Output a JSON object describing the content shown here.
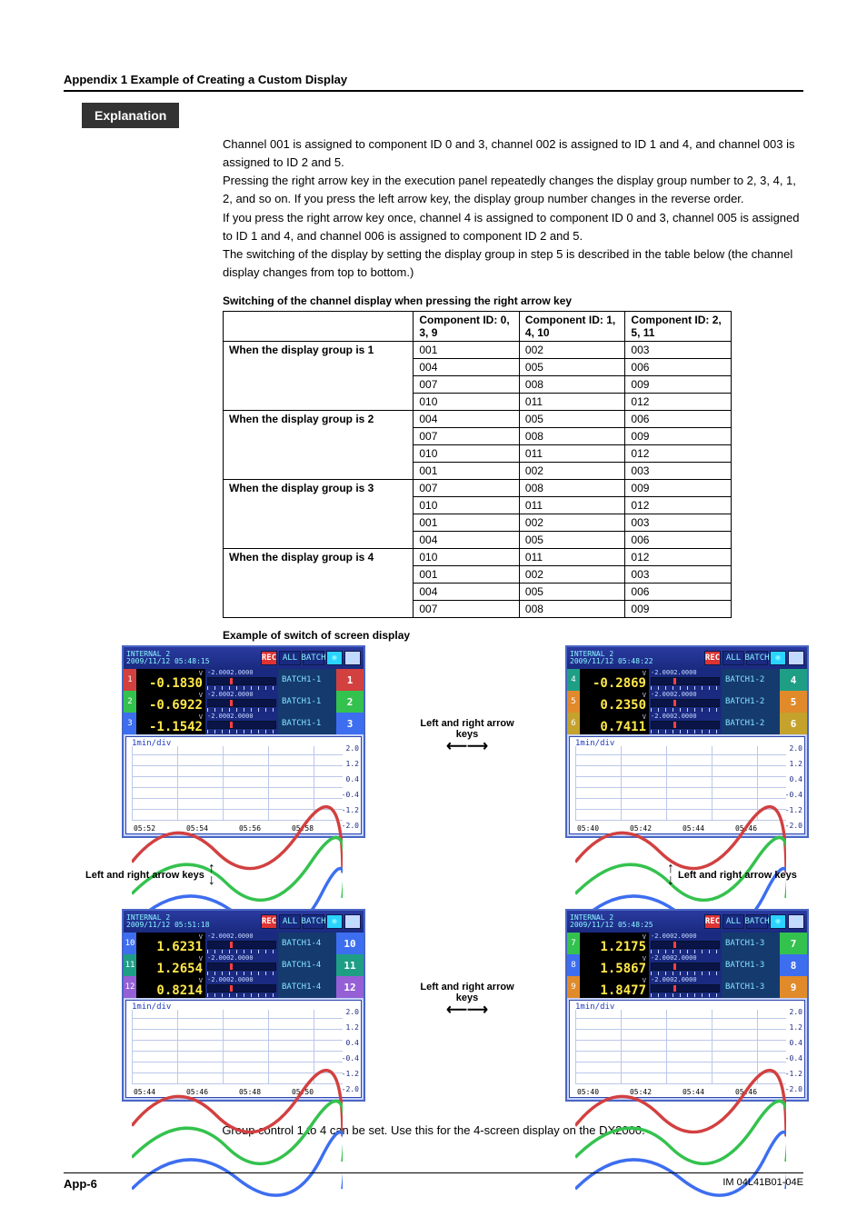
{
  "header": "Appendix 1  Example of Creating a Custom Display",
  "badge": "Explanation",
  "paragraphs": [
    "Channel 001 is assigned to component ID 0 and 3, channel 002 is assigned to ID 1 and 4, and channel 003 is assigned to ID 2 and 5.",
    "Pressing the right arrow key in the execution panel repeatedly changes the display group number to 2, 3, 4, 1, 2, and so on. If you press the left arrow key, the display group number changes in the reverse order.",
    "If you press the right arrow key once, channel 4 is assigned to component ID 0 and 3, channel 005 is assigned to ID 1 and 4, and channel 006 is assigned to component ID 2 and 5.",
    "The switching of the display by setting the display group in step 5 is described in the table below (the channel display changes from top to bottom.)"
  ],
  "tableCaption": "Switching of the channel display when pressing the right arrow key",
  "table": {
    "headers": [
      "",
      "Component ID: 0, 3, 9",
      "Component ID: 1, 4, 10",
      "Component ID: 2, 5, 11"
    ],
    "groups": [
      {
        "label": "When the display group is 1",
        "rows": [
          [
            "001",
            "002",
            "003"
          ],
          [
            "004",
            "005",
            "006"
          ],
          [
            "007",
            "008",
            "009"
          ],
          [
            "010",
            "011",
            "012"
          ]
        ]
      },
      {
        "label": "When the display group is 2",
        "rows": [
          [
            "004",
            "005",
            "006"
          ],
          [
            "007",
            "008",
            "009"
          ],
          [
            "010",
            "011",
            "012"
          ],
          [
            "001",
            "002",
            "003"
          ]
        ]
      },
      {
        "label": "When the display group is 3",
        "rows": [
          [
            "007",
            "008",
            "009"
          ],
          [
            "010",
            "011",
            "012"
          ],
          [
            "001",
            "002",
            "003"
          ],
          [
            "004",
            "005",
            "006"
          ]
        ]
      },
      {
        "label": "When the display group is 4",
        "rows": [
          [
            "010",
            "011",
            "012"
          ],
          [
            "001",
            "002",
            "003"
          ],
          [
            "004",
            "005",
            "006"
          ],
          [
            "007",
            "008",
            "009"
          ]
        ]
      }
    ]
  },
  "exampleCaption": "Example of switch of screen display",
  "screens": {
    "common": {
      "title1": "INTERNAL 2",
      "rec": "REC",
      "all": "ALL",
      "batch": "BATCH",
      "barRange": "-2.0002.0000",
      "unit": "V",
      "tdiv": "1min/div"
    },
    "tl": {
      "ts": "2009/11/12 05:48:15",
      "batch": "BATCH1-1",
      "rows": [
        {
          "ch": "1",
          "val": "-0.1830",
          "side": "1",
          "sc": "c-red"
        },
        {
          "ch": "2",
          "val": "-0.6922",
          "side": "2",
          "sc": "c-green"
        },
        {
          "ch": "3",
          "val": "-1.1542",
          "side": "3",
          "sc": "c-blue"
        }
      ],
      "x": [
        "05:52",
        "05:54",
        "05:56",
        "05:58"
      ],
      "y": [
        "2.0",
        "1.2",
        "0.4",
        "-0.4",
        "-1.2",
        "-2.0"
      ]
    },
    "tr": {
      "ts": "2009/11/12 05:48:22",
      "batch": "BATCH1-2",
      "rows": [
        {
          "ch": "4",
          "val": "-0.2869",
          "side": "4",
          "sc": "c-teal"
        },
        {
          "ch": "5",
          "val": "0.2350",
          "side": "5",
          "sc": "c-orange"
        },
        {
          "ch": "6",
          "val": "0.7411",
          "side": "6",
          "sc": "c-gold"
        }
      ],
      "x": [
        "05:40",
        "05:42",
        "05:44",
        "05:46"
      ],
      "y": [
        "2.0",
        "1.2",
        "0.4",
        "-0.4",
        "-1.2",
        "-2.0"
      ]
    },
    "bl": {
      "ts": "2009/11/12 05:51:18",
      "batch": "BATCH1-4",
      "rows": [
        {
          "ch": "10",
          "val": "1.6231",
          "side": "10",
          "sc": "c-blue"
        },
        {
          "ch": "11",
          "val": "1.2654",
          "side": "11",
          "sc": "c-teal"
        },
        {
          "ch": "12",
          "val": "0.8214",
          "side": "12",
          "sc": "c-pur"
        }
      ],
      "x": [
        "05:44",
        "05:46",
        "05:48",
        "05:50"
      ],
      "y": [
        "2.0",
        "1.2",
        "0.4",
        "-0.4",
        "-1.2",
        "-2.0"
      ]
    },
    "br": {
      "ts": "2009/11/12 05:48:25",
      "batch": "BATCH1-3",
      "rows": [
        {
          "ch": "7",
          "val": "1.2175",
          "side": "7",
          "sc": "c-green"
        },
        {
          "ch": "8",
          "val": "1.5867",
          "side": "8",
          "sc": "c-blue"
        },
        {
          "ch": "9",
          "val": "1.8477",
          "side": "9",
          "sc": "c-orange"
        }
      ],
      "x": [
        "05:40",
        "05:42",
        "05:44",
        "05:46"
      ],
      "y": [
        "2.0",
        "1.2",
        "0.4",
        "-0.4",
        "-1.2",
        "-2.0"
      ]
    }
  },
  "arrowLabel": "Left and right arrow keys",
  "bottomNote": "Group control 1 to 4 can be set. Use this for the 4-screen display on the DX2000.",
  "footer": {
    "page": "App-6",
    "doc": "IM 04L41B01-04E"
  }
}
